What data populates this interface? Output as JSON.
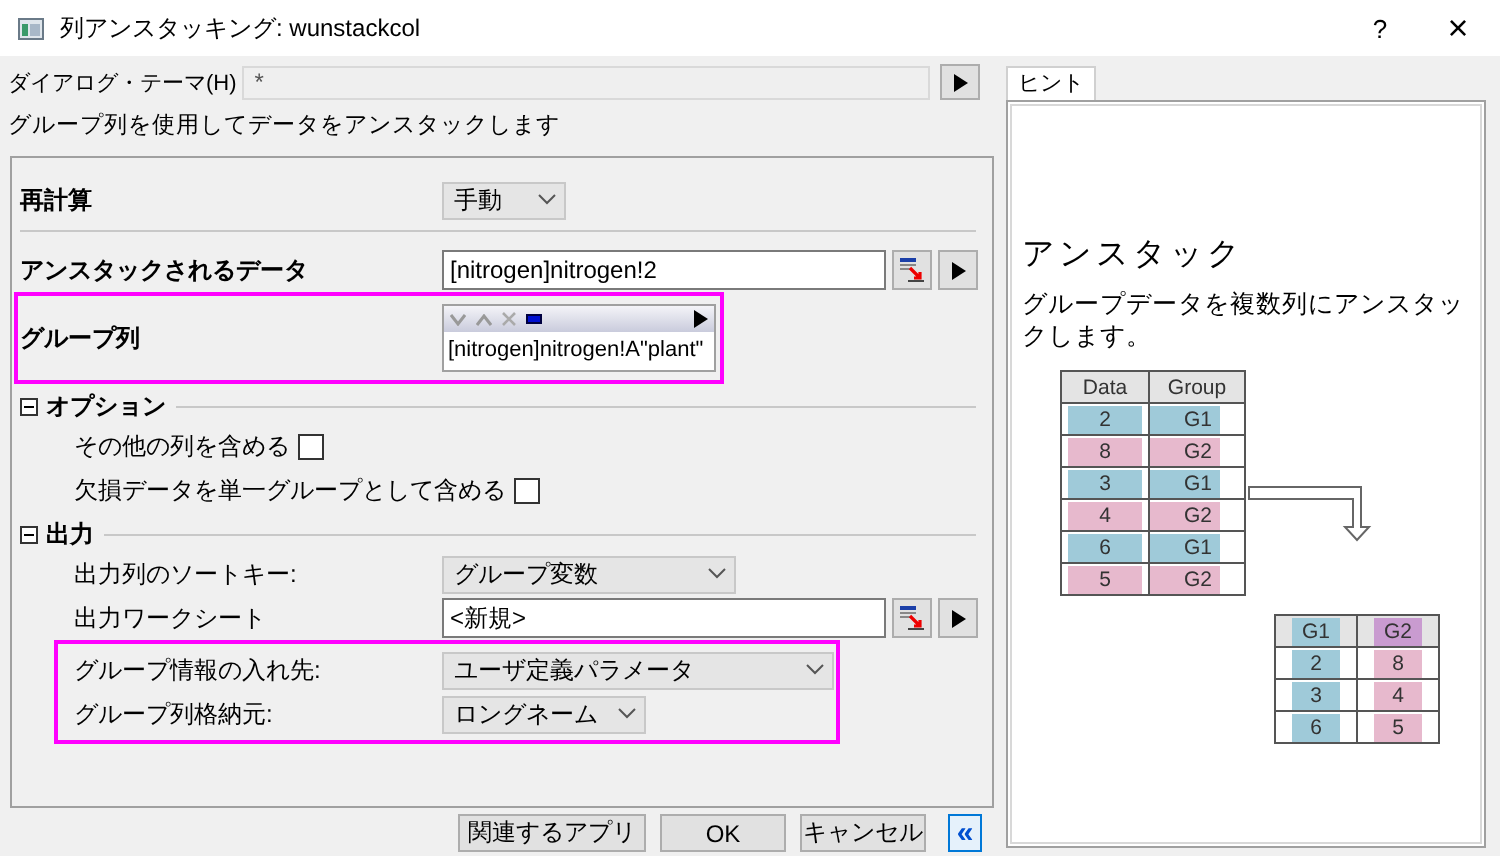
{
  "window": {
    "title": "列アンスタッキング: wunstackcol",
    "help": "?",
    "close": "×"
  },
  "theme": {
    "label": "ダイアログ・テーマ(H)",
    "value": "*"
  },
  "description": "グループ列を使用してデータをアンスタックします",
  "rows": [
    {
      "kind": "dropdown",
      "label": "再計算",
      "value": "手動",
      "highlighted": false
    },
    {
      "kind": "range",
      "label": "アンスタックされるデータ",
      "value": "[nitrogen]nitrogen!2",
      "highlighted": false
    },
    {
      "kind": "group_list",
      "label": "グループ列",
      "value": "[nitrogen]nitrogen!A\"plant\"",
      "highlighted": true
    }
  ],
  "sections": [
    {
      "title": "オプション",
      "expanded": true,
      "rows": [
        {
          "kind": "checkbox",
          "label": "その他の列を含める",
          "checked": false,
          "highlighted": false
        },
        {
          "kind": "checkbox",
          "label": "欠損データを単一グループとして含める",
          "checked": false,
          "highlighted": false
        }
      ]
    },
    {
      "title": "出力",
      "expanded": true,
      "rows": [
        {
          "kind": "dropdown",
          "label": "出力列のソートキー:",
          "value": "グループ変数",
          "highlighted": false
        },
        {
          "kind": "range",
          "label": "出力ワークシート",
          "value": "<新規>",
          "highlighted": false
        },
        {
          "kind": "dropdown",
          "label": "グループ情報の入れ先:",
          "value": "ユーザ定義パラメータ",
          "highlighted": true
        },
        {
          "kind": "dropdown",
          "label": "グループ列格納元:",
          "value": "ロングネーム",
          "highlighted": true
        }
      ]
    }
  ],
  "buttons": [
    {
      "kind": "text",
      "label": "関連するアプリ"
    },
    {
      "kind": "text",
      "label": "OK"
    },
    {
      "kind": "text",
      "label": "キャンセル"
    },
    {
      "kind": "collapse",
      "label": "«"
    }
  ],
  "hint": {
    "tabs": [
      {
        "label": "ヒント",
        "selected": true
      }
    ],
    "title": "アンスタック",
    "text": "グループデータを複数列にアンスタックします。",
    "input_table": {
      "columns": [
        "Data",
        "Group"
      ],
      "rows": [
        {
          "cells": [
            "2",
            "G1"
          ],
          "color": "#9fcad9"
        },
        {
          "cells": [
            "8",
            "G2"
          ],
          "color": "#e7b9cd"
        },
        {
          "cells": [
            "3",
            "G1"
          ],
          "color": "#9fcad9"
        },
        {
          "cells": [
            "4",
            "G2"
          ],
          "color": "#e7b9cd"
        },
        {
          "cells": [
            "6",
            "G1"
          ],
          "color": "#9fcad9"
        },
        {
          "cells": [
            "5",
            "G2"
          ],
          "color": "#e7b9cd"
        }
      ]
    },
    "output_table": {
      "columns": [
        {
          "label": "G1",
          "color": "#9fcad9"
        },
        {
          "label": "G2",
          "color": "#c99bd0"
        }
      ],
      "rows": [
        {
          "cells": [
            {
              "text": "2",
              "color": "#9fcad9"
            },
            {
              "text": "8",
              "color": "#e7b9cd"
            }
          ]
        },
        {
          "cells": [
            {
              "text": "3",
              "color": "#9fcad9"
            },
            {
              "text": "4",
              "color": "#e7b9cd"
            }
          ]
        },
        {
          "cells": [
            {
              "text": "6",
              "color": "#9fcad9"
            },
            {
              "text": "5",
              "color": "#e7b9cd"
            }
          ]
        }
      ]
    }
  }
}
